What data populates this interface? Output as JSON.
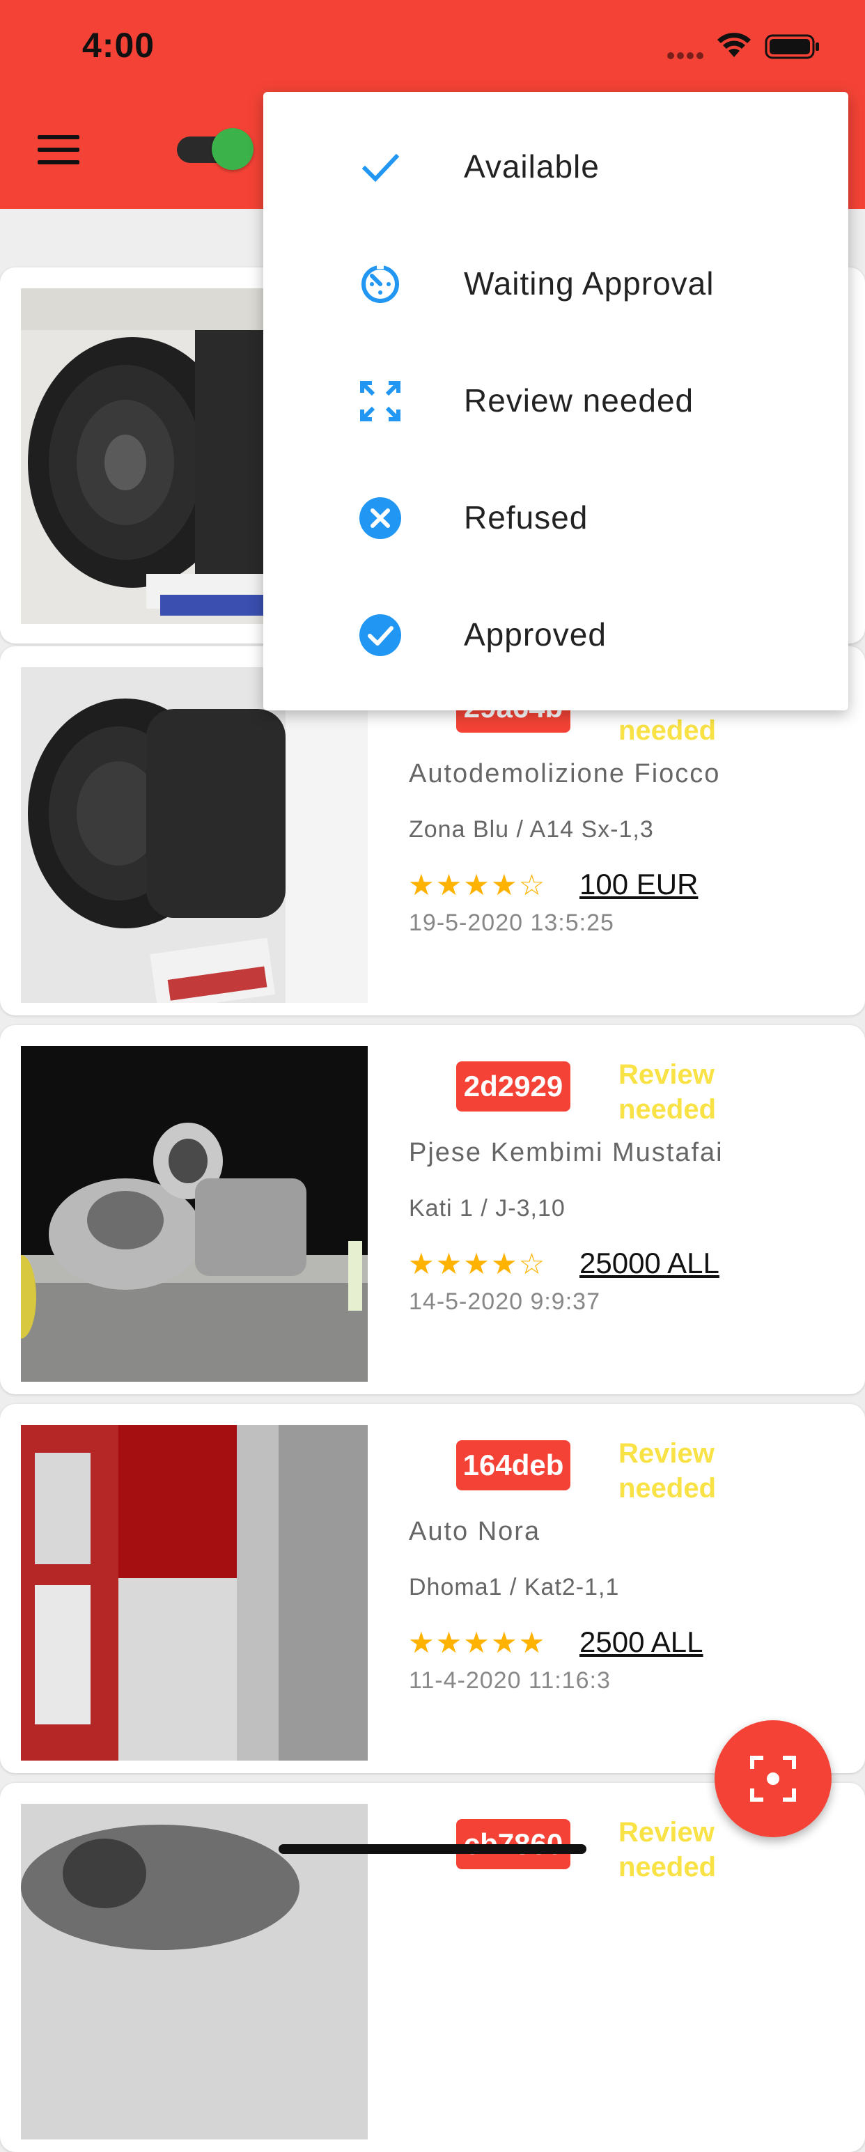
{
  "status_bar": {
    "time": "4:00"
  },
  "menu": {
    "items": [
      {
        "label": "Available",
        "icon": "check-icon"
      },
      {
        "label": "Waiting Approval",
        "icon": "timer-icon"
      },
      {
        "label": "Review needed",
        "icon": "fullscreen-icon"
      },
      {
        "label": "Refused",
        "icon": "cancel-circle-icon"
      },
      {
        "label": "Approved",
        "icon": "check-circle-icon"
      }
    ]
  },
  "cards": [
    {
      "code": "",
      "status": "",
      "shop": "",
      "location": "",
      "rating": 0,
      "price": "",
      "date": ""
    },
    {
      "code": "29a64b",
      "status": "Review needed",
      "shop": "Autodemolizione Fiocco",
      "location": "Zona Blu / A14 Sx-1,3",
      "rating": 4,
      "stars": "★★★★☆",
      "price": "100 EUR",
      "date": "19-5-2020  13:5:25"
    },
    {
      "code": "2d2929",
      "status": "Review needed",
      "shop": "Pjese Kembimi Mustafai",
      "location": "Kati 1 / J-3,10",
      "rating": 4,
      "stars": "★★★★☆",
      "price": "25000 ALL",
      "date": "14-5-2020  9:9:37"
    },
    {
      "code": "164deb",
      "status": "Review needed",
      "shop": "Auto Nora",
      "location": "Dhoma1 / Kat2-1,1",
      "rating": 5,
      "stars": "★★★★★",
      "price": "2500 ALL",
      "date": "11-4-2020  11:16:3"
    },
    {
      "code": "cb7860",
      "status": "Review needed",
      "shop": "",
      "location": "",
      "rating": 0,
      "price": "",
      "date": ""
    }
  ],
  "colors": {
    "primary": "#f44336",
    "accent_icon": "#2196f3",
    "status_yellow": "#f9e245",
    "star": "#ffb300",
    "toggle_on": "#3bb34a"
  }
}
